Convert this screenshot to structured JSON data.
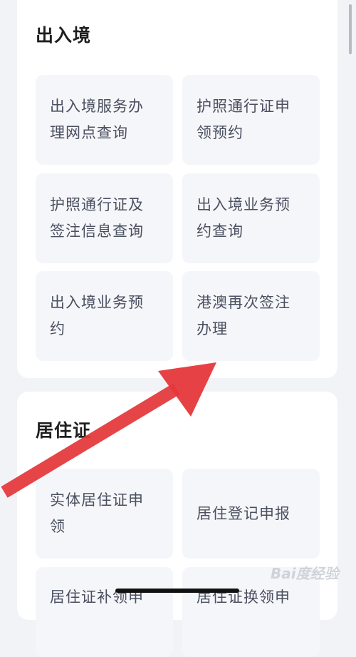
{
  "sections": [
    {
      "title": "出入境",
      "items": [
        {
          "label": "出入境服务办理网点查询"
        },
        {
          "label": "护照通行证申领预约"
        },
        {
          "label": "护照通行证及签注信息查询"
        },
        {
          "label": "出入境业务预约查询"
        },
        {
          "label": "出入境业务预约"
        },
        {
          "label": "港澳再次签注办理"
        }
      ]
    },
    {
      "title": "居住证",
      "items": [
        {
          "label": "实体居住证申领"
        },
        {
          "label": "居住登记申报"
        },
        {
          "label": "居住证补领申"
        },
        {
          "label": "居住证换领申"
        }
      ]
    }
  ],
  "watermark": "Bai度经验",
  "colors": {
    "arrow": "#e5383b",
    "tile_bg": "#f5f6f9",
    "page_bg": "#f2f3f6"
  }
}
